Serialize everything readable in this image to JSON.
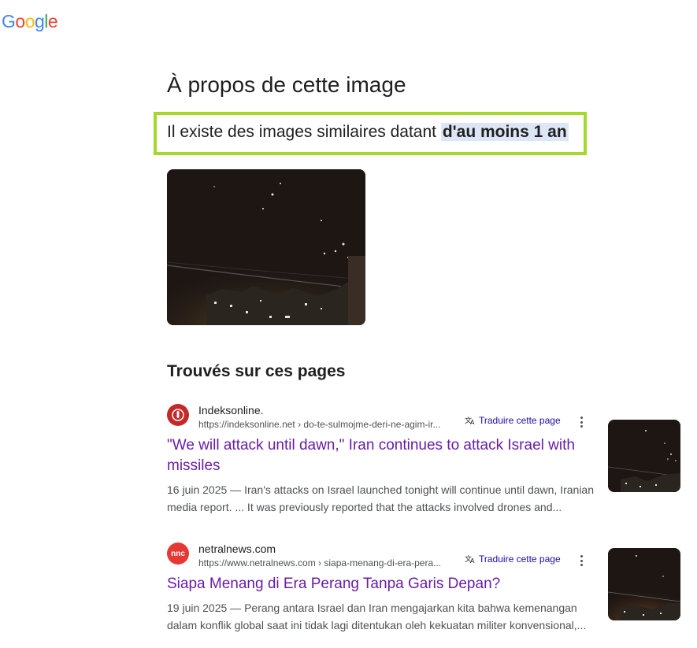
{
  "logo": {
    "letters": [
      "G",
      "o",
      "o",
      "g",
      "l",
      "e"
    ],
    "colors": [
      "#4285F4",
      "#EA4335",
      "#FBBC05",
      "#4285F4",
      "#34A853",
      "#EA4335"
    ]
  },
  "about": {
    "title": "À propos de cette image",
    "similar_prefix": "Il existe des images similaires datant ",
    "similar_highlight": "d'au moins 1 an"
  },
  "found": {
    "title": "Trouvés sur ces pages"
  },
  "results": [
    {
      "site_name": "Indeksonline.",
      "url": "https://indeksonline.net › do-te-sulmojme-deri-ne-agim-ir...",
      "translate_label": "Traduire cette page",
      "title": "\"We will attack until dawn,\" Iran continues to attack Israel with missiles",
      "snippet": "16 juin 2025 — Iran's attacks on Israel launched tonight will continue until dawn, Iranian media report. ... It was previously reported that the attacks involved drones and...",
      "favicon_color": "#c62828"
    },
    {
      "site_name": "netralnews.com",
      "url": "https://www.netralnews.com › siapa-menang-di-era-pera...",
      "translate_label": "Traduire cette page",
      "title": "Siapa Menang di Era Perang Tanpa Garis Depan?",
      "snippet": "19 juin 2025 — Perang antara Israel dan Iran mengajarkan kita bahwa kemenangan dalam konflik global saat ini tidak lagi ditentukan oleh kekuatan militer konvensional,...",
      "favicon_color": "#e53935",
      "favicon_text": "nnc"
    }
  ],
  "colors": {
    "highlight_border": "#a4d82b",
    "link_visited": "#681da8",
    "highlight_bg": "#dce6f7"
  }
}
